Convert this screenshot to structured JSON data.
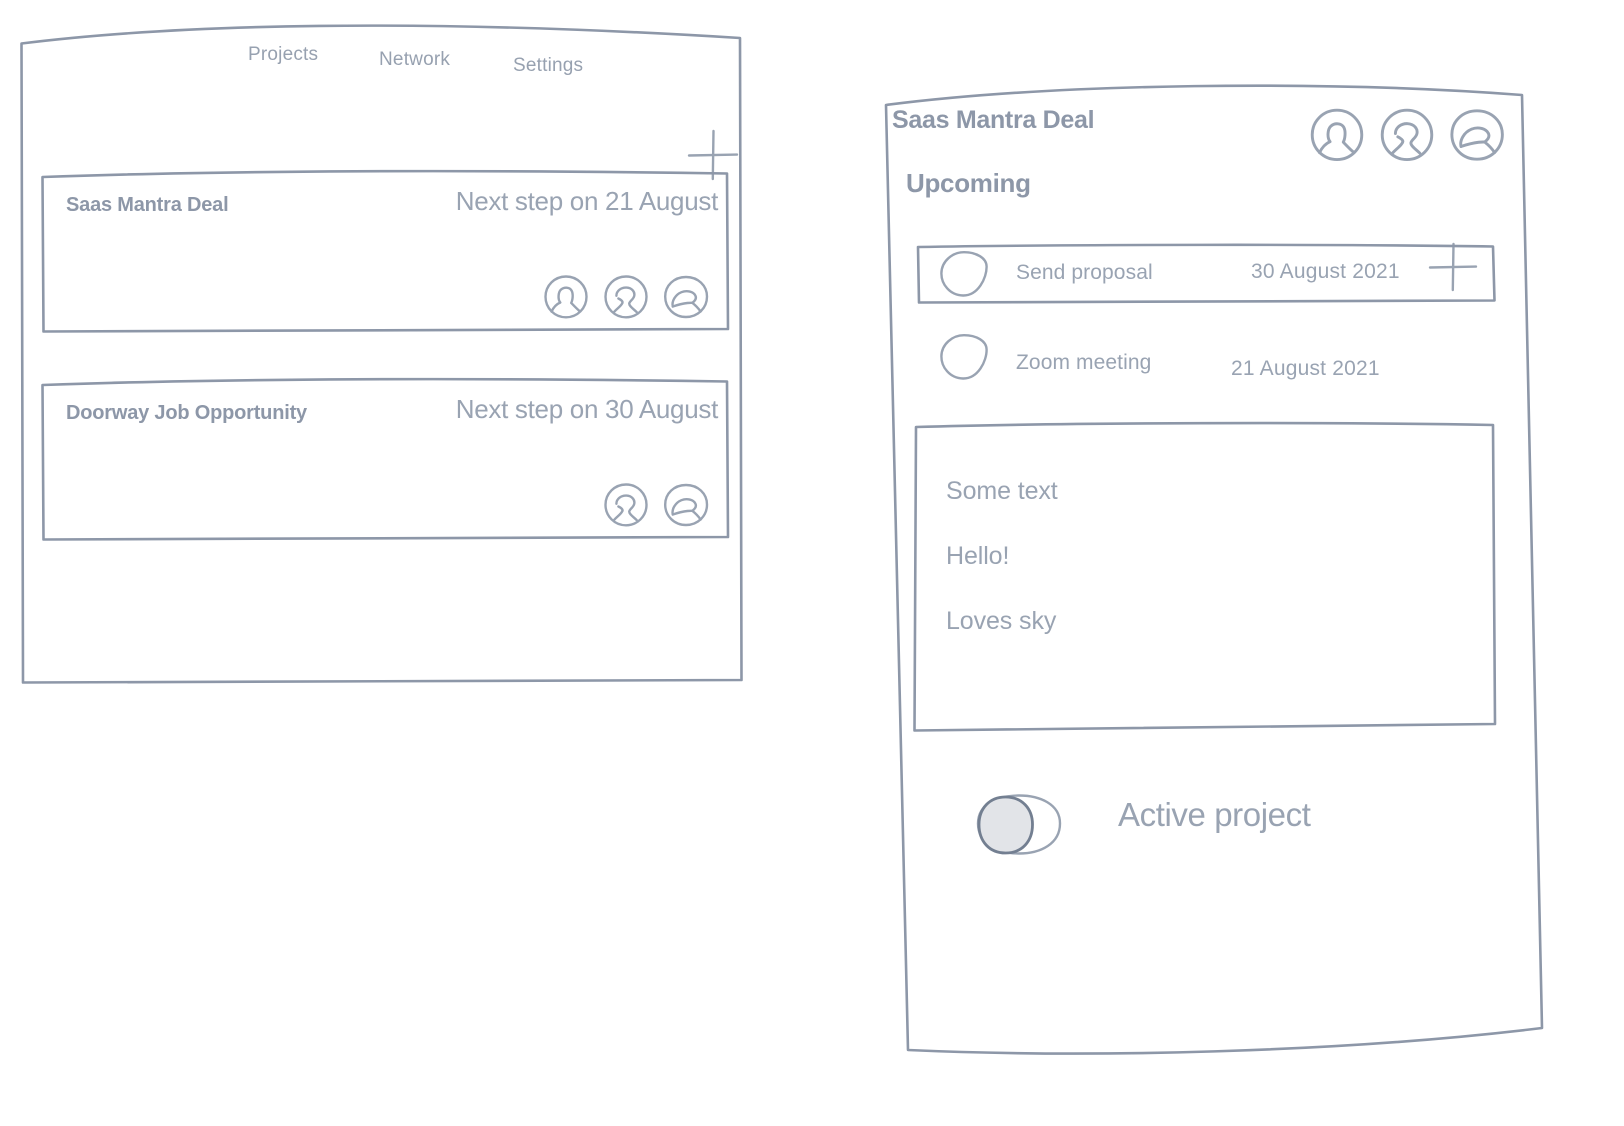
{
  "theme": {
    "stroke_color": "#8d97a8",
    "text_color": "#99a3b2",
    "heading_color": "#8d97a8",
    "background": "#ffffff",
    "toggle_knob_fill": "#e2e4e8"
  },
  "left_panel": {
    "name": "projects-list-screen",
    "nav": [
      {
        "id": "projects",
        "label": "Projects"
      },
      {
        "id": "network",
        "label": "Network"
      },
      {
        "id": "settings",
        "label": "Settings"
      }
    ],
    "add_button": {
      "icon": "plus-icon",
      "label": "+"
    },
    "projects": [
      {
        "title": "Saas Mantra Deal",
        "next_step": "Next step on 21 August",
        "avatars": [
          "avatar-icon",
          "avatar-icon",
          "avatar-icon"
        ],
        "avatar_count": 3
      },
      {
        "title": "Doorway Job Opportunity",
        "next_step": "Next step on 30 August",
        "avatars": [
          "avatar-icon",
          "avatar-icon"
        ],
        "avatar_count": 2
      }
    ]
  },
  "right_panel": {
    "name": "project-detail-screen",
    "title": "Saas Mantra Deal",
    "subtitle": "Upcoming",
    "header_avatars": [
      "avatar-icon",
      "avatar-icon",
      "avatar-icon"
    ],
    "add_button": {
      "icon": "plus-icon",
      "label": "+"
    },
    "tasks": [
      {
        "label": "Send proposal",
        "date": "30 August 2021",
        "checked": false,
        "selected": true
      },
      {
        "label": "Zoom meeting",
        "date": "21 August 2021",
        "checked": false,
        "selected": false
      }
    ],
    "notes": {
      "lines": [
        "Some text",
        "Hello!",
        "Loves sky"
      ]
    },
    "active_toggle": {
      "label": "Active project",
      "state": "off"
    }
  }
}
